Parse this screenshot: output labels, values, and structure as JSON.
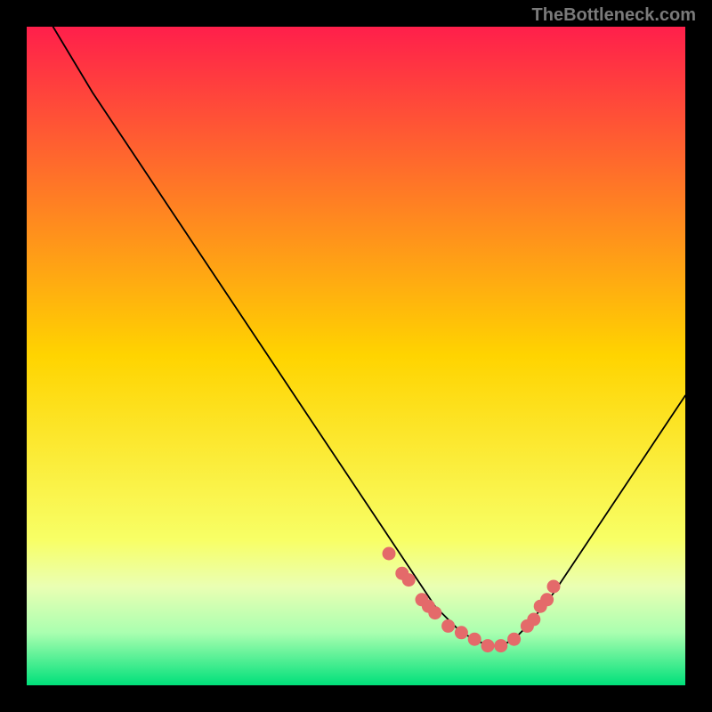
{
  "watermark": "TheBottleneck.com",
  "chart_data": {
    "type": "line",
    "title": "",
    "xlabel": "",
    "ylabel": "",
    "xlim": [
      0,
      100
    ],
    "ylim": [
      0,
      100
    ],
    "grid": false,
    "legend_position": "none",
    "gradient_stops": [
      {
        "offset": 0.0,
        "color": "#ff1f4b"
      },
      {
        "offset": 0.5,
        "color": "#ffd400"
      },
      {
        "offset": 0.78,
        "color": "#f8ff66"
      },
      {
        "offset": 0.85,
        "color": "#eaffb3"
      },
      {
        "offset": 0.92,
        "color": "#aaffb0"
      },
      {
        "offset": 1.0,
        "color": "#00e07a"
      }
    ],
    "series": [
      {
        "name": "performance-curve",
        "x": [
          4,
          7,
          10,
          14,
          18,
          22,
          26,
          30,
          34,
          38,
          42,
          46,
          50,
          54,
          56,
          58,
          60,
          62,
          64,
          66,
          68,
          70,
          72,
          74,
          76,
          80,
          84,
          88,
          92,
          96,
          100
        ],
        "y": [
          100,
          95,
          90,
          84,
          78,
          72,
          66,
          60,
          54,
          48,
          42,
          36,
          30,
          24,
          21,
          18,
          15,
          12,
          10,
          8,
          7,
          6,
          6,
          7,
          9,
          14,
          20,
          26,
          32,
          38,
          44
        ],
        "color": "#000000",
        "linewidth": 1.8
      },
      {
        "name": "optimal-markers",
        "marker_color": "#e46a6a",
        "marker_size": 9,
        "x": [
          55,
          57,
          58,
          60,
          61,
          62,
          64,
          66,
          68,
          70,
          72,
          74,
          76,
          77,
          78,
          79,
          80
        ],
        "y": [
          20,
          17,
          16,
          13,
          12,
          11,
          9,
          8,
          7,
          6,
          6,
          7,
          9,
          10,
          12,
          13,
          15
        ]
      }
    ]
  }
}
